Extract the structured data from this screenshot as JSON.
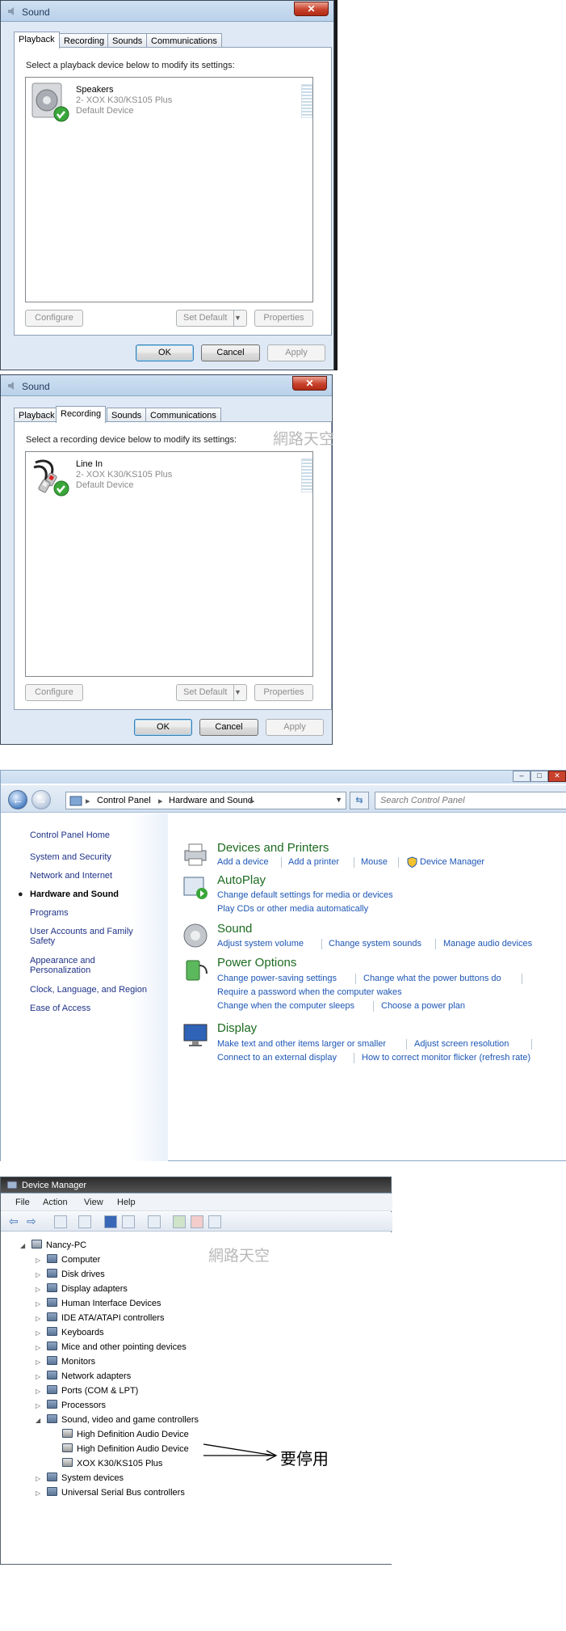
{
  "dialog1": {
    "title": "Sound",
    "tabs": [
      "Playback",
      "Recording",
      "Sounds",
      "Communications"
    ],
    "instruction": "Select a playback device below to modify its settings:",
    "device": {
      "name": "Speakers",
      "model": "2- XOX K30/KS105 Plus",
      "status": "Default Device",
      "icon": "speaker-icon"
    },
    "buttons": {
      "configure": "Configure",
      "set_default": "Set Default",
      "properties": "Properties",
      "ok": "OK",
      "cancel": "Cancel",
      "apply": "Apply"
    }
  },
  "dialog2": {
    "title": "Sound",
    "tabs": [
      "Playback",
      "Recording",
      "Sounds",
      "Communications"
    ],
    "instruction": "Select a recording device below to modify its settings:",
    "device": {
      "name": "Line In",
      "model": "2- XOX K30/KS105 Plus",
      "status": "Default Device",
      "icon": "rca-cable-icon"
    },
    "buttons": {
      "configure": "Configure",
      "set_default": "Set Default",
      "properties": "Properties",
      "ok": "OK",
      "cancel": "Cancel",
      "apply": "Apply"
    },
    "watermark": "網路天空"
  },
  "control_panel": {
    "breadcrumb": [
      "Control Panel",
      "Hardware and Sound"
    ],
    "search_placeholder": "Search Control Panel",
    "sidebar": [
      "Control Panel Home",
      "System and Security",
      "Network and Internet",
      "Hardware and Sound",
      "Programs",
      "User Accounts and Family Safety",
      "Appearance and Personalization",
      "Clock, Language, and Region",
      "Ease of Access"
    ],
    "categories": [
      {
        "title": "Devices and Printers",
        "links": [
          "Add a device",
          "Add a printer",
          "Mouse",
          "Device Manager"
        ]
      },
      {
        "title": "AutoPlay",
        "links": [
          "Change default settings for media or devices",
          "Play CDs or other media automatically"
        ]
      },
      {
        "title": "Sound",
        "links": [
          "Adjust system volume",
          "Change system sounds",
          "Manage audio devices"
        ]
      },
      {
        "title": "Power Options",
        "links": [
          "Change power-saving settings",
          "Change what the power buttons do",
          "Require a password when the computer wakes",
          "Change when the computer sleeps",
          "Choose a power plan"
        ]
      },
      {
        "title": "Display",
        "links": [
          "Make text and other items larger or smaller",
          "Adjust screen resolution",
          "Connect to an external display",
          "How to correct monitor flicker (refresh rate)"
        ]
      }
    ]
  },
  "device_manager": {
    "title": "Device Manager",
    "menu": [
      "File",
      "Action",
      "View",
      "Help"
    ],
    "watermark": "網路天空",
    "root": "Nancy-PC",
    "nodes": [
      "Computer",
      "Disk drives",
      "Display adapters",
      "Human Interface Devices",
      "IDE ATA/ATAPI controllers",
      "Keyboards",
      "Mice and other pointing devices",
      "Monitors",
      "Network adapters",
      "Ports (COM & LPT)",
      "Processors",
      "Sound, video and game controllers",
      "System devices",
      "Universal Serial Bus controllers"
    ],
    "sound_children": [
      "High Definition Audio Device",
      "High Definition Audio Device",
      "XOX K30/KS105 Plus"
    ],
    "annotation": "要停用"
  }
}
